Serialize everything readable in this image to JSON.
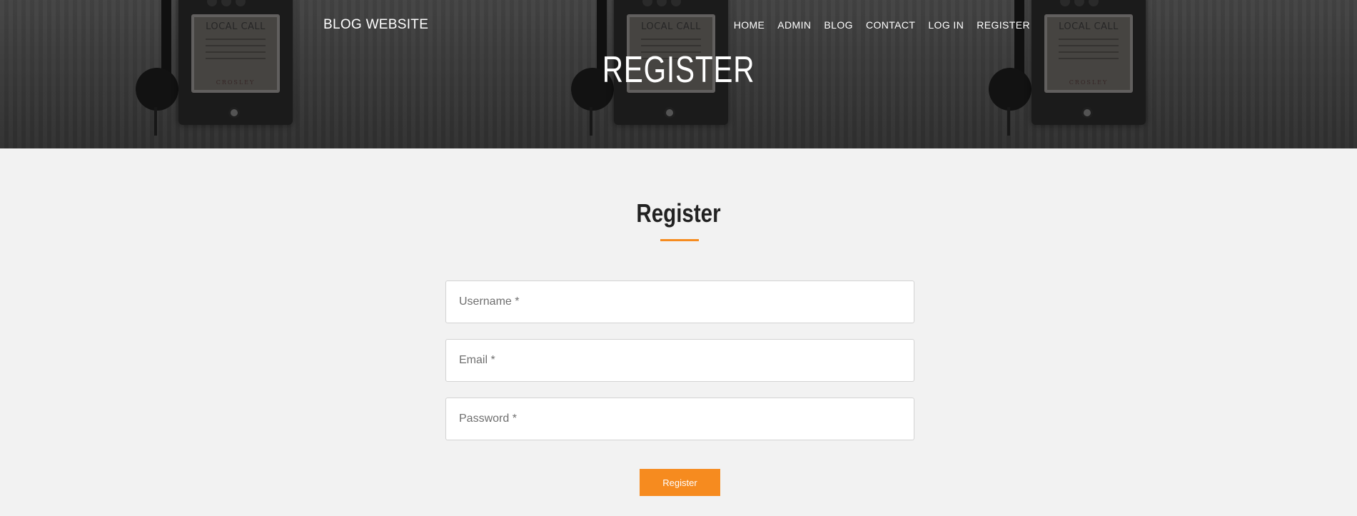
{
  "header": {
    "brand": "BLOG WEBSITE",
    "nav": [
      "HOME",
      "ADMIN",
      "BLOG",
      "CONTACT",
      "LOG IN",
      "REGISTER"
    ],
    "hero_title": "REGISTER"
  },
  "background_art": {
    "phone_card_title_1": "LOCAL CALL",
    "phone_card_title_2": "LOCAL CALL",
    "phone_card_title_3": "LOCAL CALL",
    "phone_brand": "CROSLEY"
  },
  "form": {
    "title": "Register",
    "username_placeholder": "Username *",
    "email_placeholder": "Email *",
    "password_placeholder": "Password *",
    "submit_label": "Register"
  },
  "colors": {
    "accent": "#f68b1f",
    "page_bg": "#f2f2f2",
    "hero_bg": "#3d3d3d"
  }
}
